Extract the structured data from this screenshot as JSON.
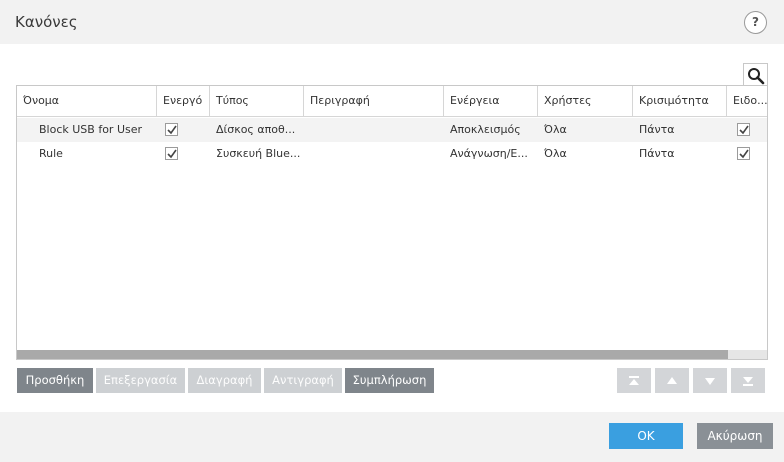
{
  "dialog": {
    "title": "Κανόνες",
    "help_label": "?"
  },
  "table": {
    "columns": [
      "Όνομα",
      "Ενεργό",
      "Τύπος",
      "Περιγραφή",
      "Ενέργεια",
      "Χρήστες",
      "Κρισιμότητα",
      "Ειδο..."
    ],
    "rows": [
      {
        "name": "Block USB for User",
        "enabled": true,
        "type": "Δίσκος αποθ...",
        "description": "",
        "action": "Αποκλεισμός",
        "users": "Όλα",
        "severity": "Πάντα",
        "notify": true
      },
      {
        "name": "Rule",
        "enabled": true,
        "type": "Συσκευή Blue...",
        "description": "",
        "action": "Ανάγνωση/Ε...",
        "users": "Όλα",
        "severity": "Πάντα",
        "notify": true
      }
    ]
  },
  "toolbar": {
    "add": "Προσθήκη",
    "edit": "Επεξεργασία",
    "delete": "Διαγραφή",
    "copy": "Αντιγραφή",
    "populate": "Συμπλήρωση"
  },
  "footer": {
    "ok": "OK",
    "cancel": "Ακύρωση"
  },
  "icons": [
    "search-icon",
    "help-icon",
    "check-icon",
    "move-top-icon",
    "move-up-icon",
    "move-down-icon",
    "move-bottom-icon"
  ],
  "colors": {
    "primary": "#3a9fe0",
    "button_dark": "#7f858b",
    "button_disabled": "#cdd0d3"
  }
}
